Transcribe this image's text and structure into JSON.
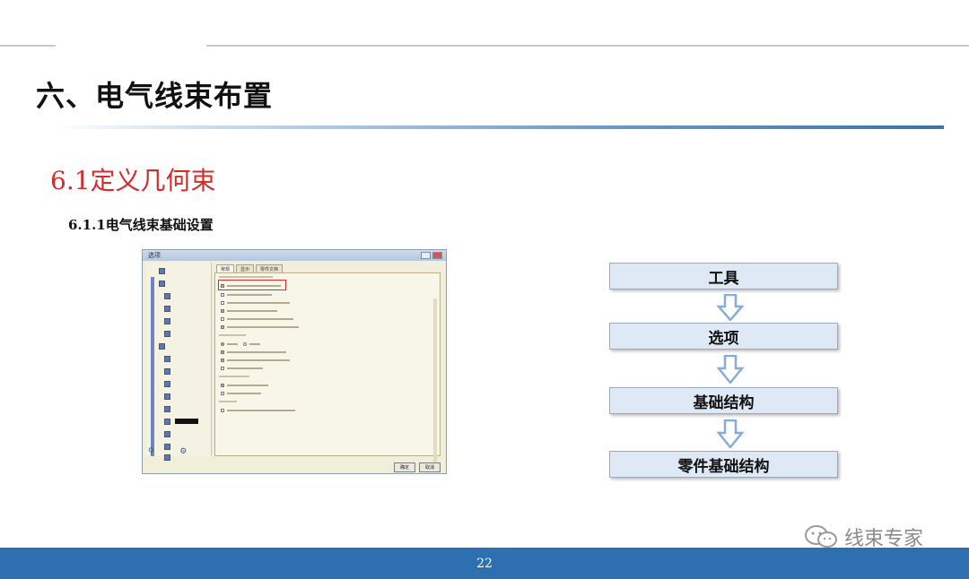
{
  "slide": {
    "title": "六、电气线束布置",
    "section": "6.1定义几何束",
    "subsection": "6.1.1电气线束基础设置",
    "page_number": "22",
    "brand": "线束专家"
  },
  "flow": {
    "steps": [
      "工具",
      "选项",
      "基础结构",
      "零件基础结构"
    ]
  },
  "dialog": {
    "title": "选项",
    "tabs": [
      "常规",
      "显示",
      "零件文档"
    ],
    "buttons": [
      "确定",
      "取消"
    ]
  },
  "colors": {
    "section_red": "#d62b2b",
    "footer_blue": "#2d6fb1",
    "flow_box_fill": "#dfe9f5",
    "arrow_blue": "#86acd9"
  }
}
